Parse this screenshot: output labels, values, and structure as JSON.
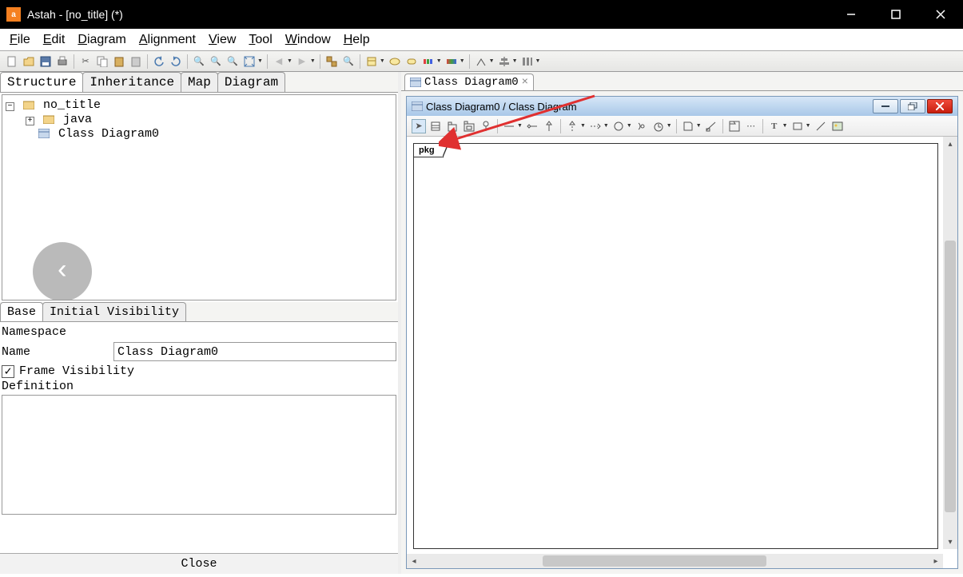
{
  "title": "Astah - [no_title] (*)",
  "menu": [
    "File",
    "Edit",
    "Diagram",
    "Alignment",
    "View",
    "Tool",
    "Window",
    "Help"
  ],
  "struct_tabs": [
    "Structure",
    "Inheritance",
    "Map",
    "Diagram"
  ],
  "tree": {
    "root": "no_title",
    "child1": "java",
    "child2": "Class Diagram0"
  },
  "prop_tabs": [
    "Base",
    "Initial Visibility"
  ],
  "props": {
    "namespace_label": "Namespace",
    "name_label": "Name",
    "name_value": "Class Diagram0",
    "frame_vis_label": "Frame Visibility",
    "definition_label": "Definition"
  },
  "close_label": "Close",
  "doc_tab": "Class Diagram0",
  "subwin_title": "Class Diagram0 / Class Diagram",
  "pkg_label": "pkg"
}
